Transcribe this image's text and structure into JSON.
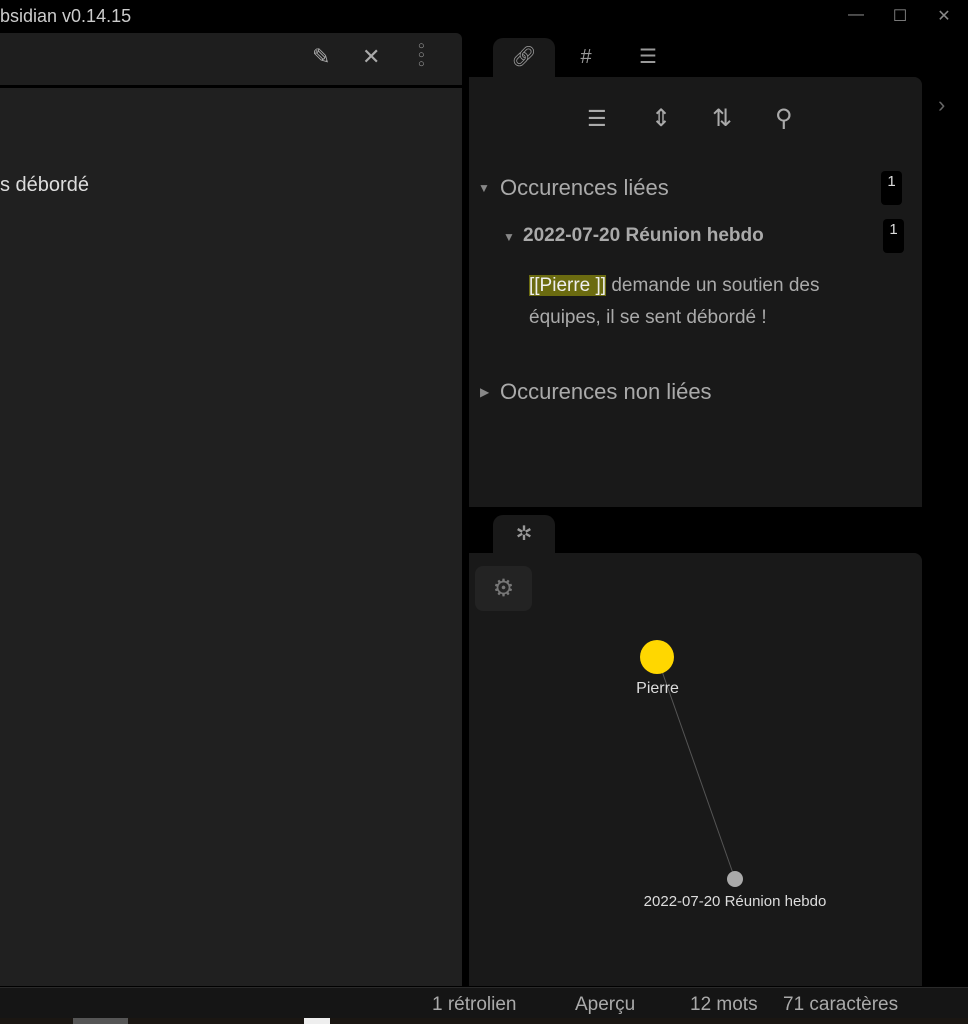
{
  "window": {
    "title": "bsidian v0.14.15"
  },
  "editor": {
    "visible_text": "s débordé"
  },
  "backlinks": {
    "linked_label": "Occurences liées",
    "linked_count": "1",
    "file": {
      "name": "2022-07-20 Réunion hebdo",
      "count": "1",
      "link": "[[Pierre ]]",
      "snippet_rest": " demande un soutien des équipes, il se sent débordé !"
    },
    "unlinked_label": "Occurences non liées"
  },
  "graph": {
    "nodes": [
      {
        "label": "Pierre",
        "color": "#ffd700"
      },
      {
        "label": "2022-07-20 Réunion hebdo",
        "color": "#aaaaaa"
      }
    ]
  },
  "status": {
    "backlinks": "1 rétrolien",
    "mode": "Aperçu",
    "words": "12 mots",
    "chars": "71 caractères"
  },
  "colors": {
    "highlight": "#6b6b10",
    "accent": "#ffd700"
  }
}
